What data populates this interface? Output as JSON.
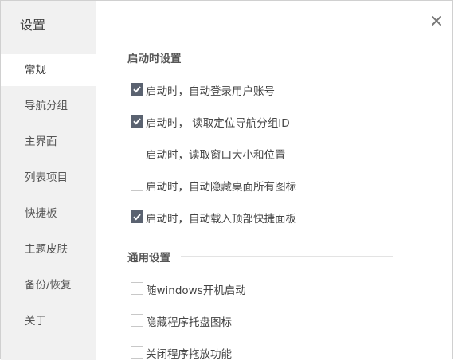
{
  "sidebar": {
    "title": "设置",
    "items": [
      {
        "label": "常规",
        "active": true
      },
      {
        "label": "导航分组"
      },
      {
        "label": "主界面"
      },
      {
        "label": "列表项目"
      },
      {
        "label": "快捷板"
      },
      {
        "label": "主题皮肤"
      },
      {
        "label": "备份/恢复"
      },
      {
        "label": "关于"
      }
    ]
  },
  "close_icon": "close-icon",
  "sections": [
    {
      "title": "启动时设置",
      "options": [
        {
          "label": "启动时，自动登录用户账号",
          "checked": true
        },
        {
          "label": "启动时， 读取定位导航分组ID",
          "checked": true
        },
        {
          "label": "启动时，读取窗口大小和位置",
          "checked": false
        },
        {
          "label": "启动时，自动隐藏桌面所有图标",
          "checked": false
        },
        {
          "label": "启动时，自动载入顶部快捷面板",
          "checked": true
        }
      ]
    },
    {
      "title": "通用设置",
      "options": [
        {
          "label": "随windows开机启动",
          "checked": false
        },
        {
          "label": "隐藏程序托盘图标",
          "checked": false
        },
        {
          "label": "关闭程序拖放功能",
          "checked": false
        }
      ]
    }
  ],
  "colors": {
    "sidebar_bg": "#f1f1f1",
    "checkbox_on": "#5a6270"
  }
}
